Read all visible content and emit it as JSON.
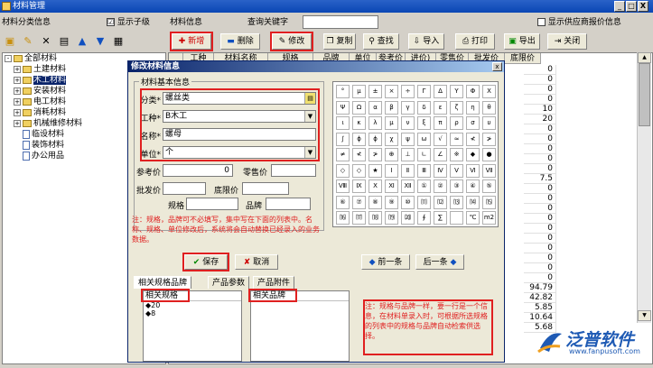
{
  "app": {
    "title": "材料管理",
    "win_min": "_",
    "win_max": "□",
    "win_close": "X"
  },
  "left": {
    "header": "材料分类信息",
    "show_sub": "显示子级",
    "checked": "☑",
    "tree": [
      {
        "label": "全部材料",
        "level": 0,
        "exp": "-",
        "icon": "folder"
      },
      {
        "label": "土建材料",
        "level": 1,
        "exp": "+",
        "icon": "folder"
      },
      {
        "label": "木工材料",
        "level": 1,
        "exp": "+",
        "icon": "folder",
        "selected": true
      },
      {
        "label": "安装材料",
        "level": 1,
        "exp": "+",
        "icon": "folder"
      },
      {
        "label": "电工材料",
        "level": 1,
        "exp": "+",
        "icon": "folder"
      },
      {
        "label": "消耗材料",
        "level": 1,
        "exp": "+",
        "icon": "folder"
      },
      {
        "label": "机械维修材料",
        "level": 1,
        "exp": "+",
        "icon": "folder"
      },
      {
        "label": "临设材料",
        "level": 2,
        "exp": "",
        "icon": "doc"
      },
      {
        "label": "装饰材料",
        "level": 2,
        "exp": "",
        "icon": "doc"
      },
      {
        "label": "办公用品",
        "level": 2,
        "exp": "",
        "icon": "doc"
      }
    ]
  },
  "right": {
    "header": "材料信息",
    "query_label": "查询关键字",
    "show_supplier": "显示供应商报价信息",
    "toolbar": [
      "新增",
      "删除",
      "修改",
      "复制",
      "查找",
      "导入",
      "打印",
      "导出",
      "关闭"
    ],
    "columns": [
      "",
      "工种",
      "材料名称",
      "规格",
      "品牌",
      "单位",
      "参考价",
      "进价)",
      "零售价",
      "批发价",
      "底限价"
    ],
    "values": [
      "0",
      "0",
      "0",
      "0",
      "10",
      "20",
      "0",
      "0",
      "0",
      "0",
      "0",
      "7.5",
      "0",
      "0",
      "0",
      "0",
      "0",
      "0",
      "0",
      "0",
      "0",
      "0",
      "94.79",
      "42.82",
      "5.85",
      "10.64",
      "5.68"
    ]
  },
  "dialog": {
    "title": "修改材料信息",
    "close": "x",
    "group_title": "材料基本信息",
    "category_label": "分类*",
    "category_value": "螺丝类",
    "type_label": "工种*",
    "type_value": "B木工",
    "name_label": "名称*",
    "name_value": "螺母",
    "unit_label": "单位*",
    "unit_value": "个",
    "ref_price_label": "参考价",
    "ref_price_value": "0",
    "retail_label": "零售价",
    "wholesale_label": "批发价",
    "floor_label": "底限价",
    "spec_label": "规格",
    "brand_label": "品牌",
    "note": "注：规格，品牌可不必填写，集中写在下面的列表中。名称、规格、单位修改后，系统将会自动替换已经录入的业务数据。",
    "save": "保存",
    "cancel": "取消",
    "prev": "前一条",
    "next": "后一条",
    "tabs": [
      "相关规格品牌",
      "产品参数",
      "产品附件"
    ],
    "spec_list_label": "相关规格",
    "brand_list_label": "相关品牌",
    "specs": [
      "20",
      "8"
    ],
    "tip": "注：规格与品牌一样，要一行是一个信息，在材料单录入时，可根据所选规格的列表中的规格与品牌自动检索供选择。",
    "symbols": [
      "°",
      "μ",
      "±",
      "×",
      "÷",
      "Γ",
      "Δ",
      "Υ",
      "Φ",
      "Χ",
      "Ψ",
      "Ω",
      "α",
      "β",
      "γ",
      "δ",
      "ε",
      "ζ",
      "η",
      "θ",
      "ι",
      "κ",
      "λ",
      "μ",
      "ν",
      "ξ",
      "π",
      "ρ",
      "σ",
      "υ",
      "∫",
      "ϕ",
      "ϕ",
      "χ",
      "ψ",
      "ω",
      "√",
      "≈",
      "≮",
      "≯",
      "≠",
      "≮",
      "≯",
      "⊕",
      "⊥",
      "∟",
      "∠",
      "※",
      "◆",
      "●",
      "◇",
      "◇",
      "★",
      "Ⅰ",
      "Ⅱ",
      "Ⅲ",
      "Ⅳ",
      "Ⅴ",
      "Ⅵ",
      "Ⅶ",
      "Ⅷ",
      "Ⅸ",
      "Ⅹ",
      "Ⅺ",
      "Ⅻ",
      "①",
      "②",
      "③",
      "④",
      "⑤",
      "⑥",
      "⑦",
      "⑧",
      "⑨",
      "⑩",
      "⑾",
      "⑿",
      "⒀",
      "⒁",
      "⒂",
      "⒃",
      "⒄",
      "⒅",
      "⒆",
      "⒇",
      "∮",
      "∑",
      "",
      "℃",
      "m2"
    ]
  },
  "logo": {
    "brand": "泛普软件",
    "url": "www.fanpusoft.com"
  },
  "colors": {
    "title_bar": "#0a46b4",
    "highlight": "#e02020",
    "selected": "#0a246a"
  }
}
